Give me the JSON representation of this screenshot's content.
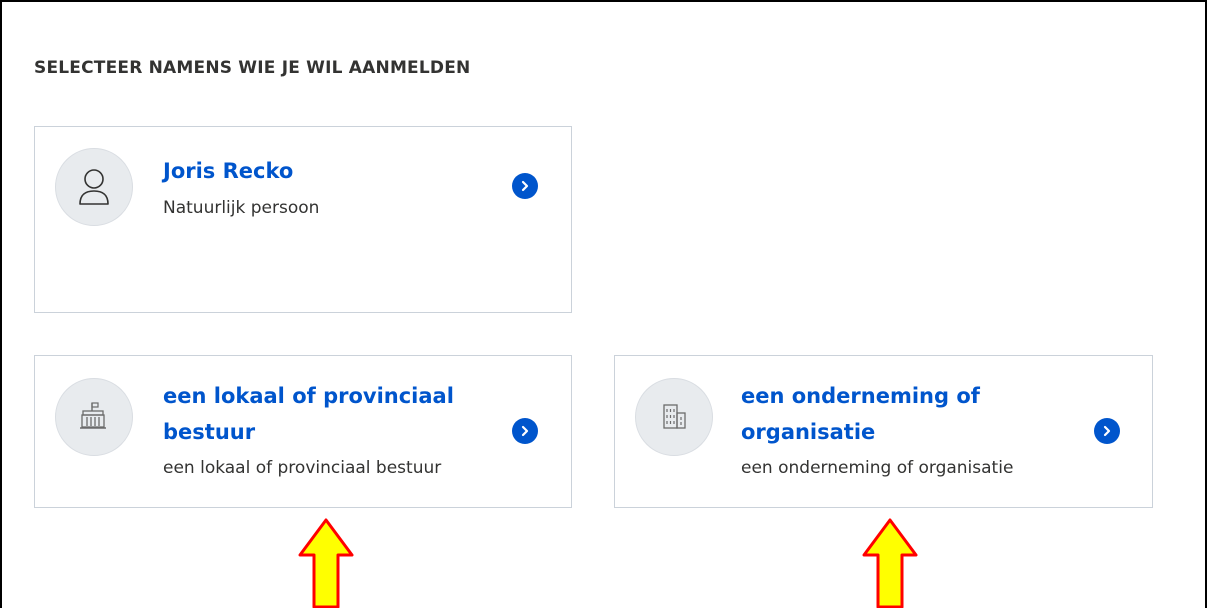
{
  "page": {
    "heading": "SELECTEER NAMENS WIE JE WIL AANMELDEN"
  },
  "options": [
    {
      "title": "Joris Recko",
      "subtitle": "Natuurlijk persoon",
      "icon": "person-icon"
    },
    {
      "title": "een lokaal of provinciaal bestuur",
      "subtitle": "een lokaal of provinciaal bestuur",
      "icon": "government-building-icon"
    },
    {
      "title": "een onderneming of organisatie",
      "subtitle": "een onderneming of organisatie",
      "icon": "office-building-icon"
    }
  ],
  "colors": {
    "accent": "#0055cc",
    "text": "#333332",
    "card_border": "#cbd2da",
    "avatar_bg": "#e8ebee",
    "annotation_arrow_fill": "#ffff00",
    "annotation_arrow_stroke": "#ff0000"
  }
}
